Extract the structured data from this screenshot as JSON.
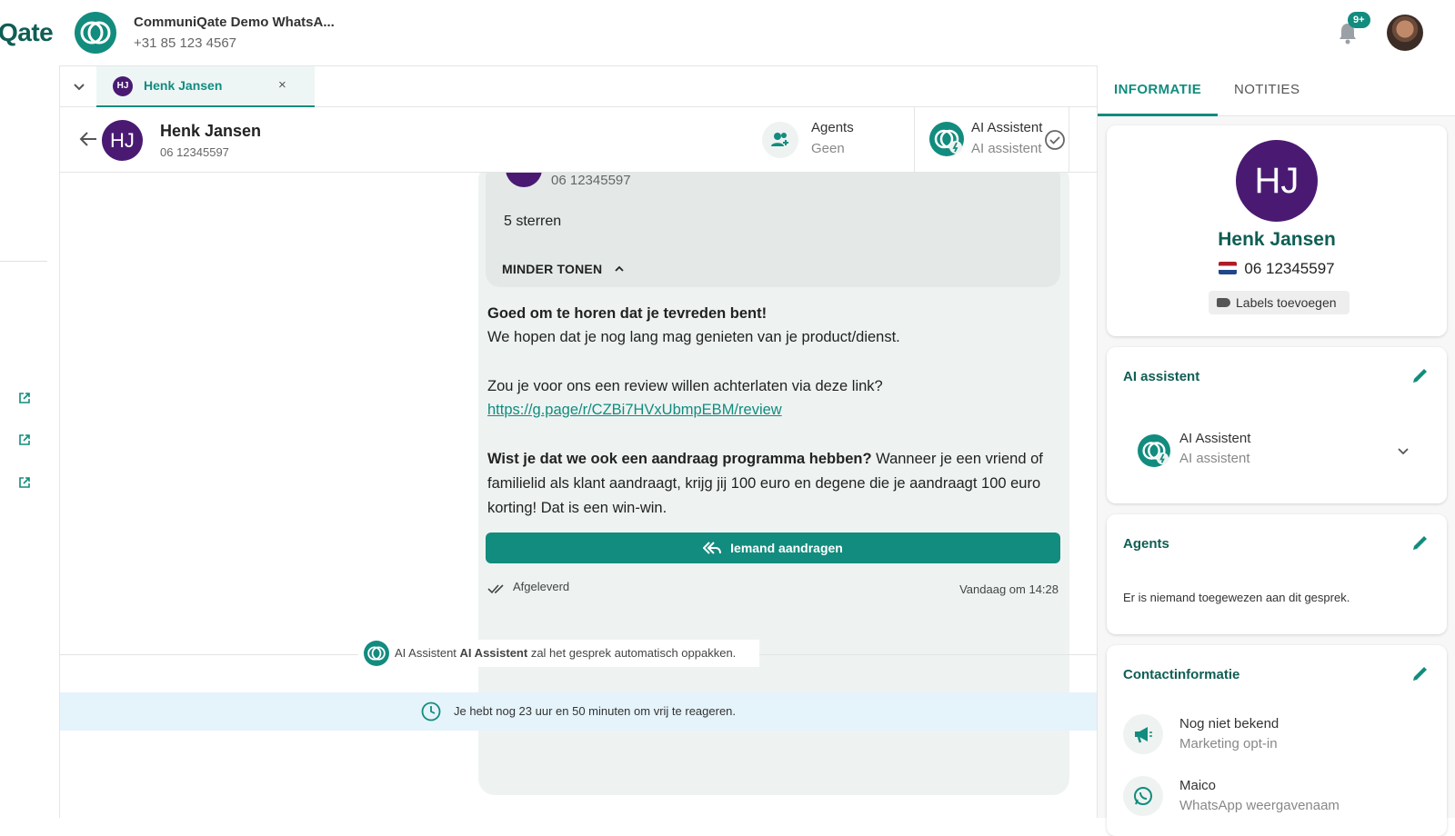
{
  "header": {
    "brand": "Qate",
    "account_name": "CommuniQate Demo WhatsA...",
    "account_phone": "+31 85 123 4567",
    "notification_badge": "9+"
  },
  "tabs": [
    {
      "initials": "HJ",
      "label": "Henk Jansen",
      "close": "×"
    }
  ],
  "conversation": {
    "initials": "HJ",
    "name": "Henk Jansen",
    "phone": "06 12345597",
    "agents_label": "Agents",
    "agents_value": "Geen",
    "ai_label": "AI Assistent",
    "ai_value": "AI assistent"
  },
  "message": {
    "quoted_phone": "06 12345597",
    "quoted_text": "5 sterren",
    "show_less": "MINDER TONEN",
    "title": "Goed om te horen dat je tevreden bent!",
    "line1": "We hopen dat je nog lang mag genieten van je product/dienst.",
    "line2": "Zou je voor ons een review willen achterlaten via deze link?",
    "link": "https://g.page/r/CZBi7HVxUbmpEBM/review",
    "p3_bold": "Wist je dat we ook een aandraag programma hebben?",
    "p3_rest": " Wanneer je een vriend of familielid als klant aandraagt, krijg jij 100 euro en degene die je aandraagt 100 euro korting! Dat is een win-win.",
    "button": "Iemand aandragen",
    "status": "Afgeleverd",
    "time": "Vandaag om 14:28"
  },
  "system": {
    "pre": "AI Assistent ",
    "bold": "AI Assistent",
    "post": " zal het gesprek automatisch oppakken.",
    "window_notice": "Je hebt nog 23 uur en 50 minuten om vrij te reageren."
  },
  "right_panel": {
    "tab_info": "INFORMATIE",
    "tab_notes": "NOTITIES",
    "profile": {
      "initials": "HJ",
      "name": "Henk Jansen",
      "phone": "06 12345597",
      "labels_button": "Labels toevoegen"
    },
    "ai_card": {
      "title": "AI assistent",
      "name": "AI Assistent",
      "sub": "AI assistent"
    },
    "agents_card": {
      "title": "Agents",
      "empty": "Er is niemand toegewezen aan dit gesprek."
    },
    "contact_card": {
      "title": "Contactinformatie",
      "items": [
        {
          "title": "Nog niet bekend",
          "sub": "Marketing opt-in"
        },
        {
          "title": "Maico",
          "sub": "WhatsApp weergavenaam"
        }
      ]
    }
  },
  "colors": {
    "accent": "#128c7e",
    "avatar": "#4a1a73",
    "notice_bg": "#e5f3fb"
  }
}
